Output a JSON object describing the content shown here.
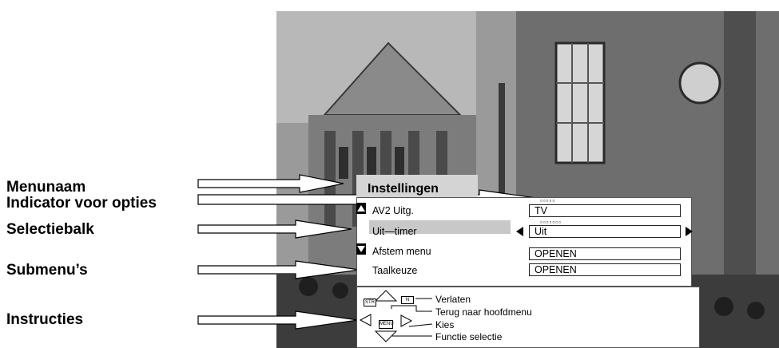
{
  "labels": {
    "menunaam": "Menunaam",
    "indicator": "Indicator voor opties",
    "selectiebalk": "Selectiebalk",
    "submenus": "Submenu’s",
    "instructies": "Instructies"
  },
  "menu": {
    "title": "Instellingen",
    "rows": [
      {
        "label": "AV2 Uitg.",
        "value": "TV",
        "dots": "▫▫▫▫▫"
      },
      {
        "label": "Uit—timer",
        "value": "Uit",
        "dots": "▫▫▫▫▫▫▫"
      },
      {
        "label": "Afstem menu",
        "value": "OPENEN"
      },
      {
        "label": "Taalkeuze",
        "value": "OPENEN"
      }
    ]
  },
  "instructions": {
    "key_str": "STR",
    "key_n": "N",
    "key_menu": "MENU",
    "verlaten": "Verlaten",
    "terug": "Terug naar hoofdmenu",
    "kies": "Kies",
    "functie": "Functie selectie"
  }
}
